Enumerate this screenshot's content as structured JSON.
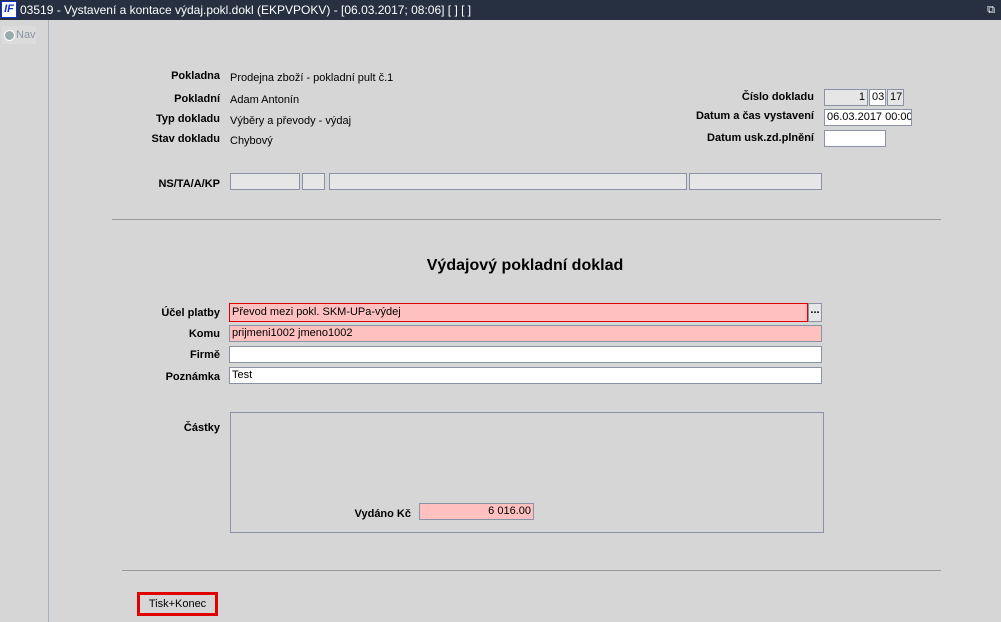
{
  "window": {
    "title": "03519 - Vystavení a kontace výdaj.pokl.dokl (EKPVPOKV) - [06.03.2017; 08:06]  [ ]  [ ]",
    "logo": "IF",
    "restore_icon": "restore-icon"
  },
  "nav": {
    "label": "Nav"
  },
  "header": {
    "pokladna_label": "Pokladna",
    "pokladna": "Prodejna zboží - pokladní pult č.1",
    "pokladni_label": "Pokladní",
    "pokladni": "Adam Antonín",
    "typ_label": "Typ dokladu",
    "typ": "Výběry a převody - výdaj",
    "stav_label": "Stav dokladu",
    "stav": "Chybový",
    "cislo_label": "Číslo dokladu",
    "cislo": [
      "1",
      "03",
      "17"
    ],
    "datum_label": "Datum a čas vystavení",
    "datum": "06.03.2017 00:00",
    "usk_label": "Datum usk.zd.plnění",
    "usk": "",
    "ns_label": "NS/TA/A/KP"
  },
  "doc": {
    "heading": "Výdajový pokladní doklad",
    "ucel_label": "Účel platby",
    "ucel": "Převod mezi pokl. SKM-UPa-výdej",
    "ucel_btn": "...",
    "komu_label": "Komu",
    "komu": "prijmeni1002 jmeno1002",
    "firme_label": "Firmě",
    "firme": "",
    "poznamka_label": "Poznámka",
    "poznamka": "Test",
    "castky_label": "Částky",
    "vydano_label": "Vydáno Kč",
    "vydano": "6 016.00"
  },
  "footer": {
    "print_close": "Tisk+Konec"
  }
}
